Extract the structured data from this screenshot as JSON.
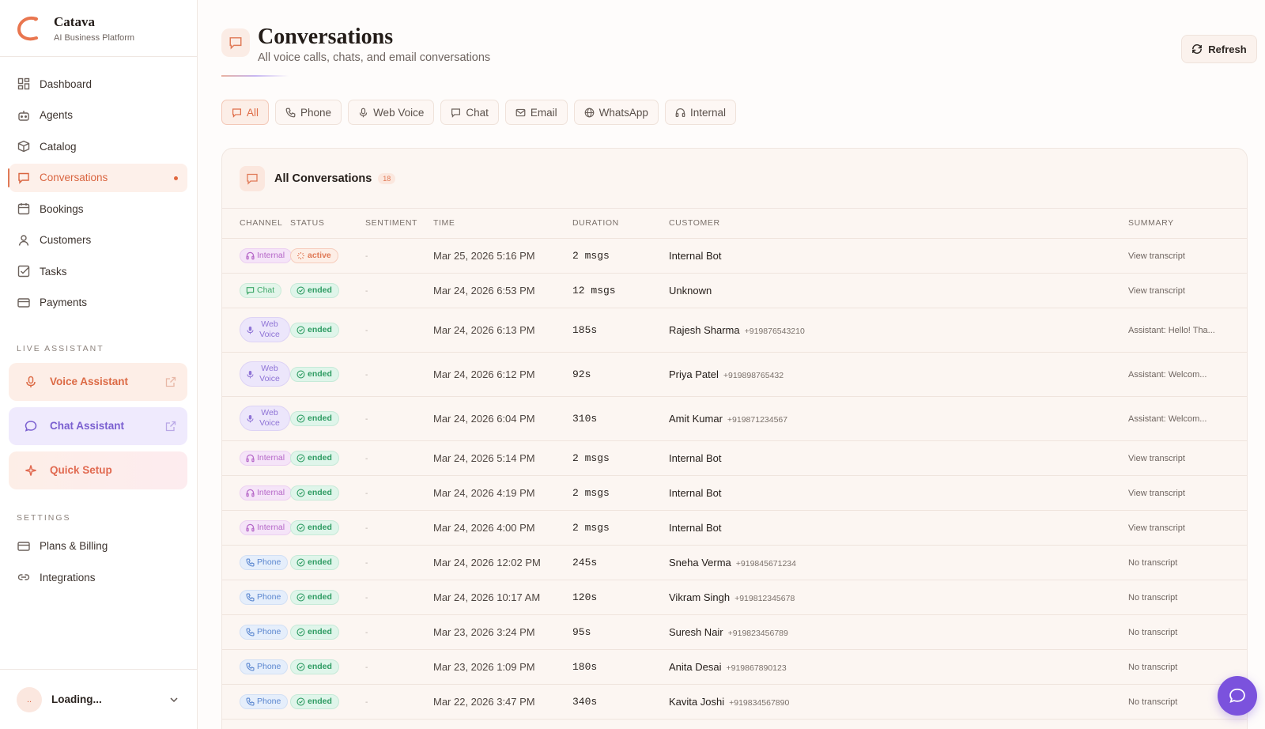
{
  "brand": {
    "name": "Catava",
    "subtitle": "AI Business Platform"
  },
  "nav": [
    {
      "label": "Dashboard",
      "icon": "dashboard-icon"
    },
    {
      "label": "Agents",
      "icon": "robot-icon"
    },
    {
      "label": "Catalog",
      "icon": "box-icon"
    },
    {
      "label": "Conversations",
      "icon": "message-icon",
      "active": true
    },
    {
      "label": "Bookings",
      "icon": "calendar-icon"
    },
    {
      "label": "Customers",
      "icon": "user-icon"
    },
    {
      "label": "Tasks",
      "icon": "checkbox-icon"
    },
    {
      "label": "Payments",
      "icon": "card-icon"
    }
  ],
  "live_assistant": {
    "section_label": "LIVE ASSISTANT",
    "voice": "Voice Assistant",
    "chat": "Chat Assistant",
    "setup": "Quick Setup"
  },
  "settings": {
    "section_label": "SETTINGS",
    "items": [
      {
        "label": "Plans & Billing",
        "icon": "card-icon"
      },
      {
        "label": "Integrations",
        "icon": "link-icon"
      }
    ]
  },
  "user": {
    "avatar": "..",
    "name": "Loading..."
  },
  "header": {
    "title": "Conversations",
    "subtitle": "All voice calls, chats, and email conversations",
    "refresh": "Refresh"
  },
  "filters": [
    {
      "label": "All",
      "active": true
    },
    {
      "label": "Phone"
    },
    {
      "label": "Web Voice"
    },
    {
      "label": "Chat"
    },
    {
      "label": "Email"
    },
    {
      "label": "WhatsApp"
    },
    {
      "label": "Internal"
    }
  ],
  "card": {
    "title": "All Conversations",
    "count": "18"
  },
  "table": {
    "columns": [
      "CHANNEL",
      "STATUS",
      "SENTIMENT",
      "TIME",
      "DURATION",
      "CUSTOMER",
      "SUMMARY"
    ],
    "rows": [
      {
        "channel": "Internal",
        "status": "active",
        "sentiment": "-",
        "time": "Mar 25, 2026 5:16 PM",
        "duration": "2 msgs",
        "customer": "Internal Bot",
        "phone": "",
        "summary": "View transcript"
      },
      {
        "channel": "Chat",
        "status": "ended",
        "sentiment": "-",
        "time": "Mar 24, 2026 6:53 PM",
        "duration": "12 msgs",
        "customer": "Unknown",
        "phone": "",
        "summary": "View transcript"
      },
      {
        "channel": "Web Voice",
        "status": "ended",
        "sentiment": "-",
        "time": "Mar 24, 2026 6:13 PM",
        "duration": "185s",
        "customer": "Rajesh Sharma",
        "phone": "+919876543210",
        "summary": "Assistant: Hello! Tha..."
      },
      {
        "channel": "Web Voice",
        "status": "ended",
        "sentiment": "-",
        "time": "Mar 24, 2026 6:12 PM",
        "duration": "92s",
        "customer": "Priya Patel",
        "phone": "+919898765432",
        "summary": "Assistant: Welcom..."
      },
      {
        "channel": "Web Voice",
        "status": "ended",
        "sentiment": "-",
        "time": "Mar 24, 2026 6:04 PM",
        "duration": "310s",
        "customer": "Amit Kumar",
        "phone": "+919871234567",
        "summary": "Assistant: Welcom..."
      },
      {
        "channel": "Internal",
        "status": "ended",
        "sentiment": "-",
        "time": "Mar 24, 2026 5:14 PM",
        "duration": "2 msgs",
        "customer": "Internal Bot",
        "phone": "",
        "summary": "View transcript"
      },
      {
        "channel": "Internal",
        "status": "ended",
        "sentiment": "-",
        "time": "Mar 24, 2026 4:19 PM",
        "duration": "2 msgs",
        "customer": "Internal Bot",
        "phone": "",
        "summary": "View transcript"
      },
      {
        "channel": "Internal",
        "status": "ended",
        "sentiment": "-",
        "time": "Mar 24, 2026 4:00 PM",
        "duration": "2 msgs",
        "customer": "Internal Bot",
        "phone": "",
        "summary": "View transcript"
      },
      {
        "channel": "Phone",
        "status": "ended",
        "sentiment": "-",
        "time": "Mar 24, 2026 12:02 PM",
        "duration": "245s",
        "customer": "Sneha Verma",
        "phone": "+919845671234",
        "summary": "No transcript"
      },
      {
        "channel": "Phone",
        "status": "ended",
        "sentiment": "-",
        "time": "Mar 24, 2026 10:17 AM",
        "duration": "120s",
        "customer": "Vikram Singh",
        "phone": "+919812345678",
        "summary": "No transcript"
      },
      {
        "channel": "Phone",
        "status": "ended",
        "sentiment": "-",
        "time": "Mar 23, 2026 3:24 PM",
        "duration": "95s",
        "customer": "Suresh Nair",
        "phone": "+919823456789",
        "summary": "No transcript"
      },
      {
        "channel": "Phone",
        "status": "ended",
        "sentiment": "-",
        "time": "Mar 23, 2026 1:09 PM",
        "duration": "180s",
        "customer": "Anita Desai",
        "phone": "+919867890123",
        "summary": "No transcript"
      },
      {
        "channel": "Phone",
        "status": "ended",
        "sentiment": "-",
        "time": "Mar 22, 2026 3:47 PM",
        "duration": "340s",
        "customer": "Kavita Joshi",
        "phone": "+919834567890",
        "summary": "No transcript"
      }
    ]
  },
  "colors": {
    "accent": "#e07a57",
    "purple": "#7b52dd",
    "ended_green": "#2f9c63"
  }
}
